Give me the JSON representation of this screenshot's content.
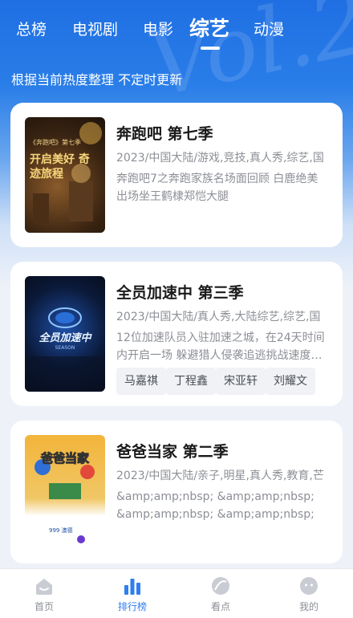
{
  "tabs": [
    {
      "label": "总榜"
    },
    {
      "label": "电视剧"
    },
    {
      "label": "电影"
    },
    {
      "label": "综艺",
      "active": true
    },
    {
      "label": "动漫"
    }
  ],
  "subtitle": "根据当前热度整理 不定时更新",
  "cards": [
    {
      "title": "奔跑吧 第七季",
      "meta": "2023/中国大陆/游戏,竞技,真人秀,综艺,国",
      "desc": "奔跑吧7之奔跑家族名场面回顾 白鹿绝美出场坐王鹤棣郑恺大腿",
      "poster_text": "《奔跑吧》第七季",
      "poster_text2": "开启美好 奇迹旅程",
      "tags": []
    },
    {
      "title": "全员加速中 第三季",
      "meta": "2023/中国大陆/真人秀,大陆综艺,综艺,国",
      "desc": "12位加速队员入驻加速之城，在24天时间内开启一场 躲避猎人侵袭追逃挑战速度…",
      "poster_text": "全员加速中",
      "poster_text2": "SEASON",
      "tags": [
        "马嘉祺",
        "丁程鑫",
        "宋亚轩",
        "刘耀文"
      ]
    },
    {
      "title": "爸爸当家 第二季",
      "meta": "2023/中国大陆/亲子,明星,真人秀,教育,芒",
      "desc": "&amp;amp;nbsp; &amp;amp;nbsp; &amp;amp;nbsp; &amp;amp;nbsp;《爸…",
      "poster_text": "爸爸当家",
      "poster_text2": "999 澳德",
      "tags": []
    }
  ],
  "nav": [
    {
      "label": "首页",
      "icon": "home-icon"
    },
    {
      "label": "排行榜",
      "icon": "ranking-icon",
      "active": true
    },
    {
      "label": "看点",
      "icon": "highlight-icon"
    },
    {
      "label": "我的",
      "icon": "profile-icon"
    }
  ],
  "colors": {
    "accent": "#2f7ef0",
    "hero": "#1f6fe3"
  }
}
